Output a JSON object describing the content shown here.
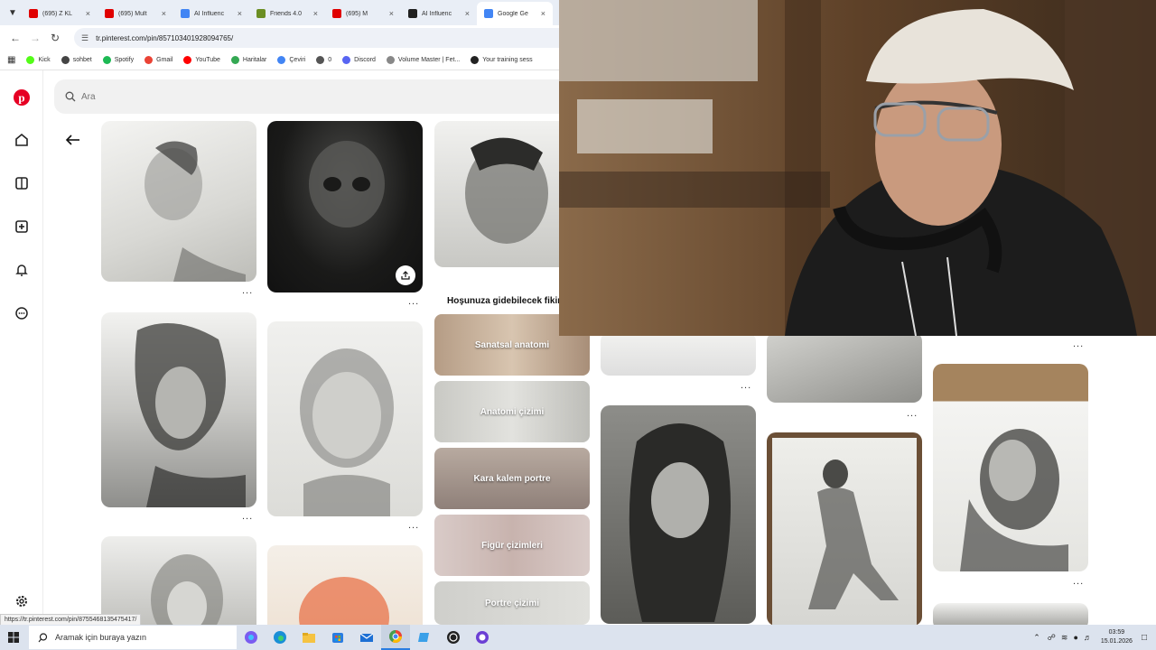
{
  "browser": {
    "tabs": [
      {
        "title": "(695) Z KL",
        "color": "#e00000",
        "active": false
      },
      {
        "title": "(695) Mult",
        "color": "#e00000",
        "active": false
      },
      {
        "title": "AI Influenc",
        "color": "#4285f4",
        "active": false
      },
      {
        "title": "Friends 4.0",
        "color": "#6b8e23",
        "active": false
      },
      {
        "title": "(695) M",
        "color": "#e00000",
        "active": false
      },
      {
        "title": "AI Influenc",
        "color": "#202020",
        "active": false
      },
      {
        "title": "Google Ge",
        "color": "#4285f4",
        "active": true
      }
    ],
    "url": "tr.pinterest.com/pin/857103401928094765/",
    "bookmarks": [
      "Kick",
      "sohbet",
      "Spotify",
      "Gmail",
      "YouTube",
      "Haritalar",
      "Çeviri",
      "0",
      "Discord",
      "Volume Master | Fet...",
      "Your training sess"
    ]
  },
  "pinterest": {
    "search_placeholder": "Ara",
    "suggest_title": "Hoşunuza gidebilecek fikirler",
    "chips": [
      "Sanatsal anatomi",
      "Anatomi çizimi",
      "Kara kalem portre",
      "Figür çizimleri",
      "Portre çizimi"
    ],
    "more_glyph": "...",
    "status_url": "https://tr.pinterest.com/pin/8755468135475417/"
  },
  "taskbar": {
    "search_placeholder": "Aramak için buraya yazın",
    "time": "03:59",
    "date": "15.01.2026"
  },
  "colors": {
    "pinterest_red": "#e60023",
    "taskbar": "#dce3ee"
  }
}
